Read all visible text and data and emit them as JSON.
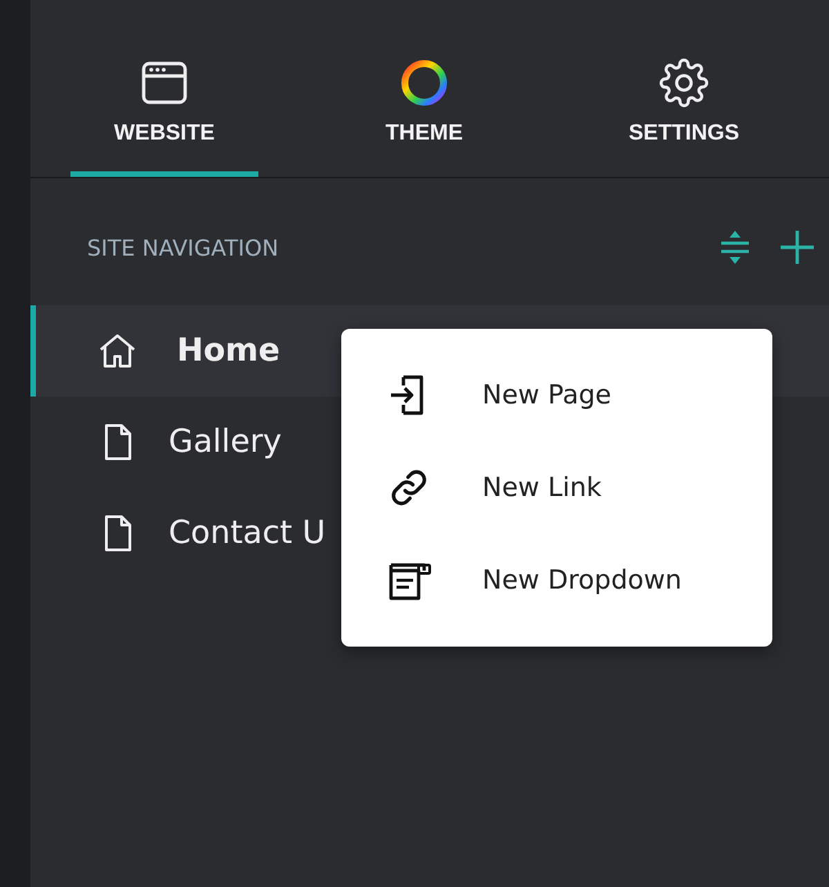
{
  "tabs": [
    {
      "label": "WEBSITE",
      "kind": "window",
      "selected": true
    },
    {
      "label": "THEME",
      "kind": "ring",
      "selected": false
    },
    {
      "label": "SETTINGS",
      "kind": "gear",
      "selected": false
    }
  ],
  "section": {
    "title": "SITE NAVIGATION"
  },
  "nav_items": [
    {
      "label": "Home",
      "kind": "home",
      "selected": true
    },
    {
      "label": "Gallery",
      "kind": "page",
      "selected": false
    },
    {
      "label": "Contact U",
      "kind": "page",
      "selected": false
    }
  ],
  "menu": {
    "items": [
      {
        "label": "New Page",
        "kind": "page"
      },
      {
        "label": "New Link",
        "kind": "link"
      },
      {
        "label": "New Dropdown",
        "kind": "dropdown"
      }
    ]
  }
}
